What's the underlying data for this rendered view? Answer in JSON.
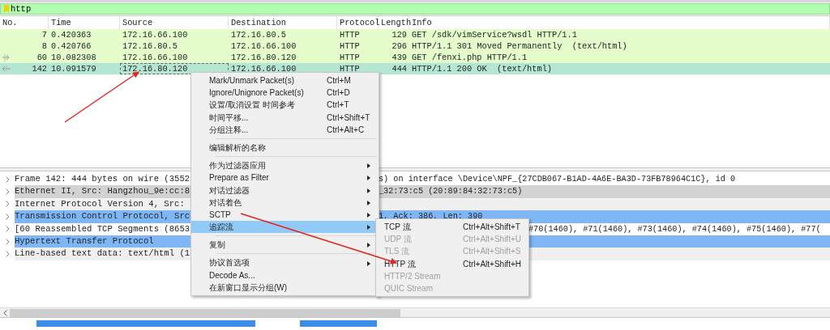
{
  "filter": {
    "value": "http"
  },
  "packet_list": {
    "columns": [
      "No.",
      "Time",
      "Source",
      "Destination",
      "Protocol",
      "Length",
      "Info"
    ],
    "rows": [
      {
        "cells": [
          "7",
          "0.420363",
          "172.16.66.100",
          "172.16.80.5",
          "HTTP",
          "129",
          "GET /sdk/vimService?wsdl HTTP/1.1"
        ],
        "selected": false
      },
      {
        "cells": [
          "8",
          "0.420766",
          "172.16.80.5",
          "172.16.66.100",
          "HTTP",
          "296",
          "HTTP/1.1 301 Moved Permanently  (text/html)"
        ],
        "selected": false
      },
      {
        "cells": [
          "60",
          "10.082308",
          "172.16.66.100",
          "172.16.80.120",
          "HTTP",
          "439",
          "GET /fenxi.php HTTP/1.1"
        ],
        "selected": false,
        "related_request": true
      },
      {
        "cells": [
          "142",
          "10.091579",
          "172.16.80.120",
          "172.16.66.100",
          "HTTP",
          "444",
          "HTTP/1.1 200 OK  (text/html)"
        ],
        "selected": true,
        "related_response": true
      }
    ]
  },
  "details": [
    {
      "left": "Frame 142: 444 bytes on wire (3552",
      "right": "s) on interface \\Device\\NPF_{27CDB067-B1AD-4A6E-BA3D-73FB78964C1C}, id 0",
      "kind": "plain"
    },
    {
      "left": "Ethernet II, Src: Hangzhou_9e:cc:8",
      "right": "_32:73:c5 (20:89:84:32:73:c5)",
      "kind": "shaded"
    },
    {
      "left": "Internet Protocol Version 4, Src:",
      "kind": "light"
    },
    {
      "left": "Transmission Control Protocol, Src",
      "right": "1, Ack: 386, Len: 390",
      "kind": "highlighted"
    },
    {
      "left": "[60 Reassembled TCP Segments (8653",
      "right": "#70(1460), #71(1460), #73(1460), #74(1460), #75(1460), #77(",
      "kind": "plain"
    },
    {
      "left": "Hypertext Transfer Protocol",
      "kind": "highlighted"
    },
    {
      "left": "Line-based text data: text/html (1",
      "kind": "light"
    }
  ],
  "context_menu": [
    {
      "kind": "item",
      "label": "Mark/Unmark Packet(s)",
      "shortcut": "Ctrl+M"
    },
    {
      "kind": "item",
      "label": "Ignore/Unignore Packet(s)",
      "shortcut": "Ctrl+D"
    },
    {
      "kind": "item",
      "label": "设置/取消设置 时间参考",
      "shortcut": "Ctrl+T"
    },
    {
      "kind": "item",
      "label": "时间平移...",
      "shortcut": "Ctrl+Shift+T"
    },
    {
      "kind": "item",
      "label": "分组注释...",
      "shortcut": "Ctrl+Alt+C"
    },
    {
      "kind": "separator"
    },
    {
      "kind": "item",
      "label": "编辑解析的名称"
    },
    {
      "kind": "separator"
    },
    {
      "kind": "item",
      "label": "作为过滤器应用",
      "has_submenu": true
    },
    {
      "kind": "item",
      "label": "Prepare as Filter",
      "has_submenu": true
    },
    {
      "kind": "item",
      "label": "对话过滤器",
      "has_submenu": true
    },
    {
      "kind": "item",
      "label": "对话着色",
      "has_submenu": true
    },
    {
      "kind": "item",
      "label": "SCTP",
      "has_submenu": true
    },
    {
      "kind": "item",
      "label": "追踪流",
      "has_submenu": true,
      "selected": true
    },
    {
      "kind": "separator"
    },
    {
      "kind": "item",
      "label": "复制",
      "has_submenu": true
    },
    {
      "kind": "separator"
    },
    {
      "kind": "item",
      "label": "协议首选项",
      "has_submenu": true
    },
    {
      "kind": "item",
      "label": "Decode As..."
    },
    {
      "kind": "item",
      "label": "在新窗口显示分组(W)"
    }
  ],
  "submenu": [
    {
      "label": "TCP 流",
      "shortcut": "Ctrl+Alt+Shift+T",
      "disabled": false
    },
    {
      "label": "UDP 流",
      "shortcut": "Ctrl+Alt+Shift+U",
      "disabled": true
    },
    {
      "label": "TLS 流",
      "shortcut": "Ctrl+Alt+Shift+S",
      "disabled": true
    },
    {
      "label": "HTTP 流",
      "shortcut": "Ctrl+Alt+Shift+H",
      "disabled": false
    },
    {
      "label": "HTTP/2 Stream",
      "disabled": true
    },
    {
      "label": "QUIC Stream",
      "disabled": true
    }
  ]
}
